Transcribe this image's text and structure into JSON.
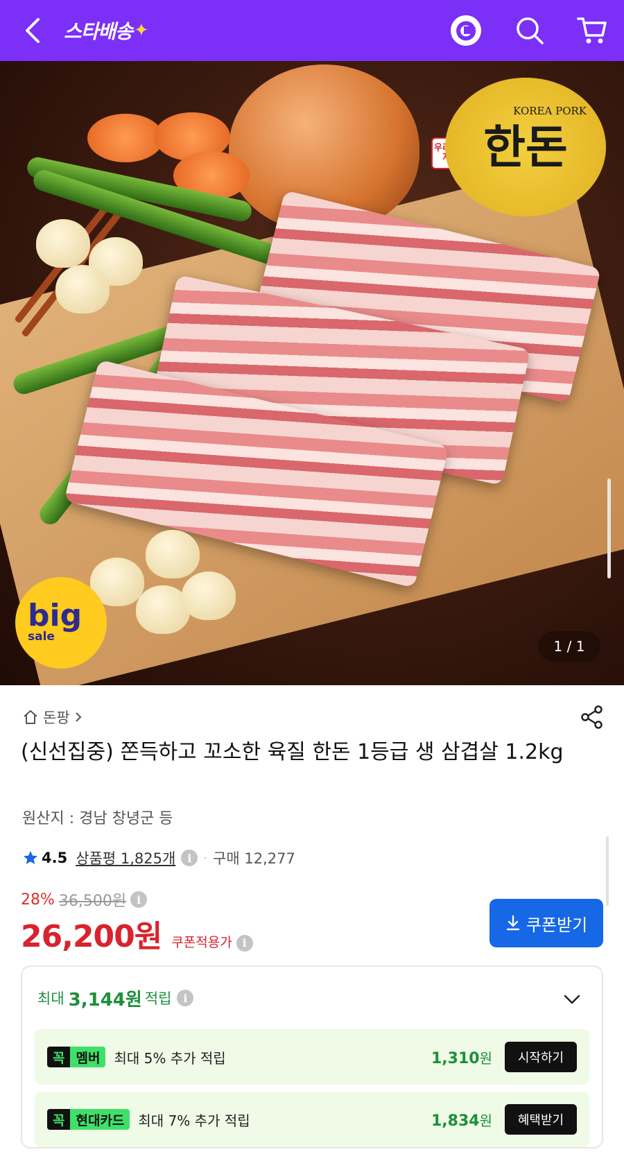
{
  "header": {
    "logo_text": "스타배송",
    "logo_spark": "✦",
    "background_color": "#7b2ff7"
  },
  "hero": {
    "seal": {
      "tag": "우리돼지",
      "main": "한돈",
      "sub": "KOREA PORK"
    },
    "badge": {
      "big": "big",
      "sale": "sale"
    },
    "page_indicator": "1 / 1"
  },
  "product": {
    "breadcrumb": "돈팡",
    "title": "(신선집중) 쫀득하고 꼬소한 육질 한돈 1등급 생 삼겹살 1.2kg",
    "origin": "원산지 : 경남 창녕군 등",
    "rating": "4.5",
    "review_label": "상품평 1,825개",
    "purchase_label": "구매 12,277",
    "discount_rate": "28%",
    "original_price": "36,500원",
    "price": "26,200원",
    "price_note": "쿠폰적용가",
    "coupon_button": "쿠폰받기"
  },
  "reward": {
    "prefix": "최대",
    "amount": "3,144원",
    "suffix": "적립",
    "items": [
      {
        "kk": "꼭",
        "name": "멤버",
        "desc": "최대 5% 추가 적립",
        "value": "1,310",
        "unit": "원",
        "button": "시작하기"
      },
      {
        "kk": "꼭",
        "name": "현대카드",
        "desc": "최대 7% 추가 적립",
        "value": "1,834",
        "unit": "원",
        "button": "혜택받기"
      }
    ]
  },
  "colors": {
    "brand_purple": "#7b2ff7",
    "price_red": "#d9232d",
    "coupon_blue": "#1668e6",
    "reward_green": "#1d8f3a"
  }
}
